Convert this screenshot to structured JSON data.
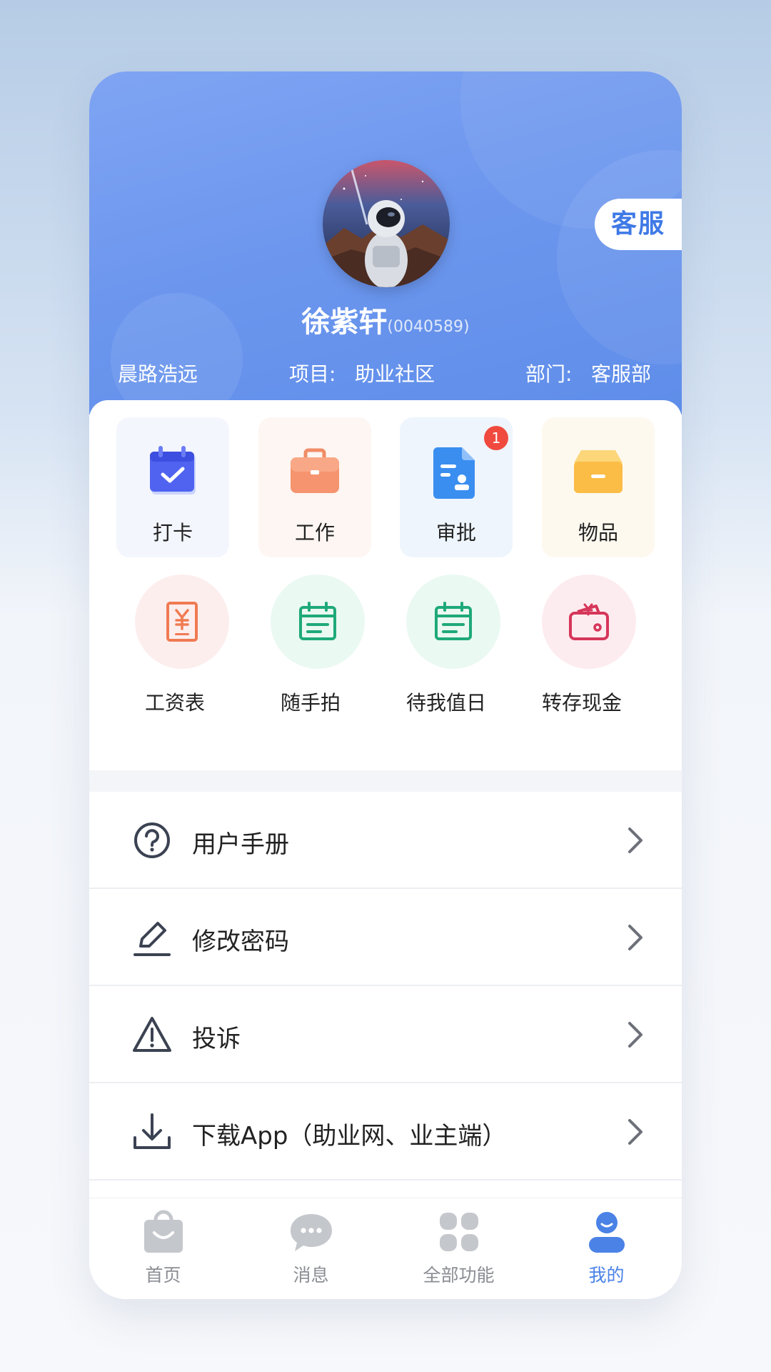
{
  "profile": {
    "name": "徐紫轩",
    "employee_id": "(0040589)",
    "company": "晨路浩远",
    "project_label": "项目:",
    "project_value": "助业社区",
    "department_label": "部门:",
    "department_value": "客服部",
    "service_button": "客服"
  },
  "quick_tiles": [
    {
      "label": "打卡",
      "icon": "calendar-check-icon"
    },
    {
      "label": "工作",
      "icon": "briefcase-icon"
    },
    {
      "label": "审批",
      "icon": "approval-document-icon",
      "badge": "1"
    },
    {
      "label": "物品",
      "icon": "box-icon"
    }
  ],
  "tools": [
    {
      "label": "工资表",
      "icon": "salary-slip-icon"
    },
    {
      "label": "随手拍",
      "icon": "calendar-note-icon"
    },
    {
      "label": "待我值日",
      "icon": "calendar-duty-icon"
    },
    {
      "label": "转存现金",
      "icon": "wallet-icon"
    }
  ],
  "menu": [
    {
      "label": "用户手册",
      "icon": "question-circle-icon"
    },
    {
      "label": "修改密码",
      "icon": "pencil-icon"
    },
    {
      "label": "投诉",
      "icon": "warning-icon"
    },
    {
      "label": "下载App（助业网、业主端）",
      "icon": "download-icon"
    }
  ],
  "tabbar": [
    {
      "label": "首页",
      "icon": "bag-icon"
    },
    {
      "label": "消息",
      "icon": "chat-icon"
    },
    {
      "label": "全部功能",
      "icon": "grid-icon"
    },
    {
      "label": "我的",
      "icon": "user-icon",
      "active": true
    }
  ],
  "colors": {
    "header_start": "#7fa4f3",
    "header_end": "#5e8de9",
    "accent": "#4a82e6",
    "badge": "#f04a3e"
  }
}
